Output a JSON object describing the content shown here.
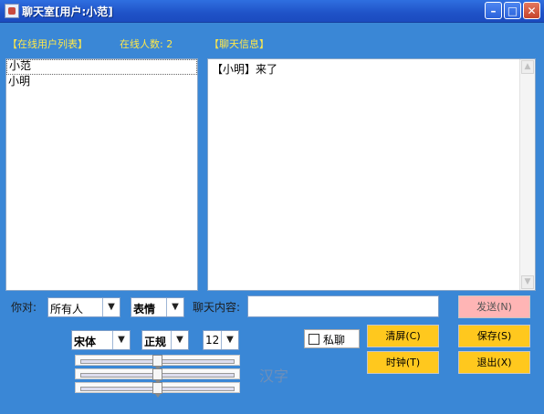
{
  "window": {
    "title": "聊天室[用户:小范]",
    "min": "–",
    "max": "□",
    "close": "✕"
  },
  "headers": {
    "online_list": "【在线用户列表】",
    "online_count": "在线人数: 2",
    "chat_info": "【聊天信息】"
  },
  "users": [
    "小范",
    "小明"
  ],
  "chat_messages": [
    "【小明】来了"
  ],
  "controls": {
    "to_label": "你对:",
    "to_value": "所有人",
    "emotion_value": "表情",
    "content_label": "聊天内容:",
    "font_value": "宋体",
    "style_value": "正规",
    "size_value": "12",
    "private_label": "私聊",
    "private_checked": false,
    "preview_text": "汉字",
    "slider_levels": [
      0.5,
      0.5,
      0.5
    ]
  },
  "buttons": {
    "send": "发送(N)",
    "save": "保存(S)",
    "clear": "清屏(C)",
    "clock": "时钟(T)",
    "exit": "退出(X)"
  },
  "colors": {
    "background": "#3a87d6",
    "header_text": "#ffe84a",
    "button": "#ffc81e",
    "send_button": "#ffb5b5"
  },
  "icons": {
    "dropdown": "▼",
    "scroll_up": "▲",
    "scroll_down": "▼",
    "checkbox": "☐"
  }
}
